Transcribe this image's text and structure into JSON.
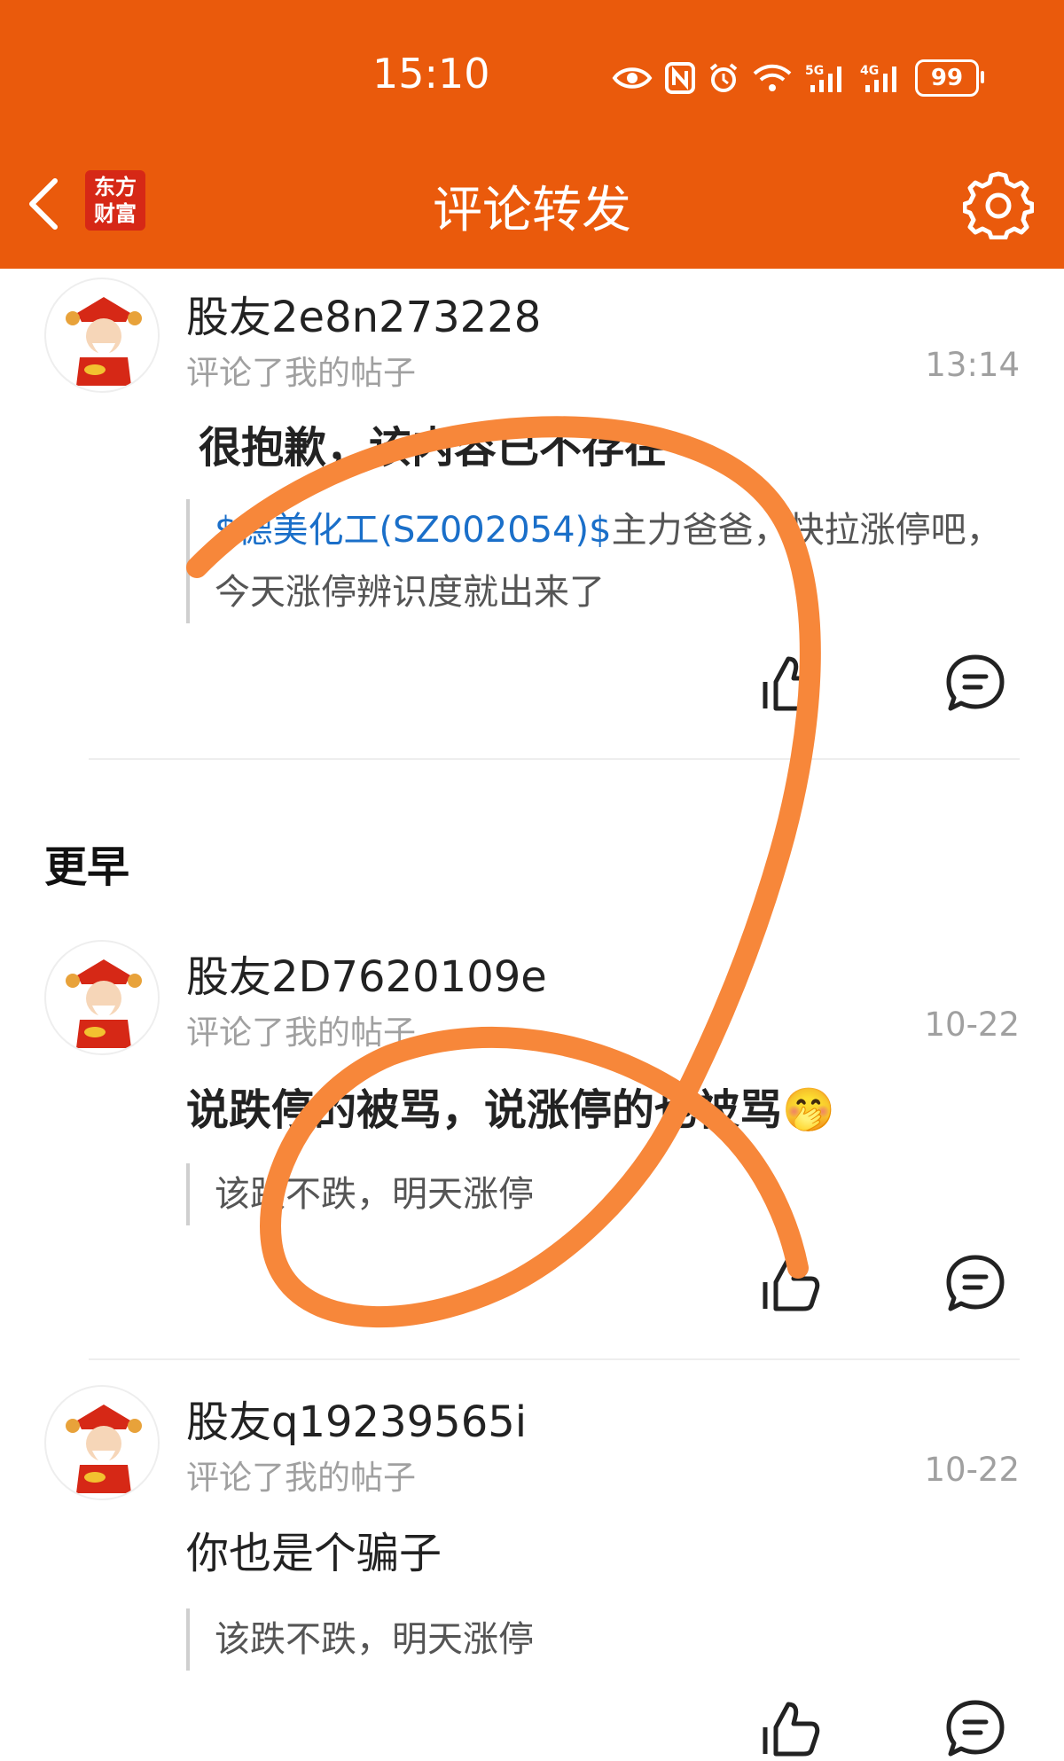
{
  "status_bar": {
    "time": "15:10",
    "icons": [
      "eye-icon",
      "nfc-icon",
      "alarm-icon",
      "wifi-icon",
      "5g-signal-icon",
      "4g-signal-icon"
    ],
    "battery": "99"
  },
  "header": {
    "back_icon": "chevron-left-icon",
    "logo_line1": "东方",
    "logo_line2": "财富",
    "title": "评论转发",
    "settings_icon": "gear-icon"
  },
  "notifications": [
    {
      "user": "股友2e8n273228",
      "action": "评论了我的帖子",
      "time": "13:14",
      "content": "很抱歉，该内容已不存在",
      "quote_link": "$德美化工(SZ002054)$",
      "quote_text": "主力爸爸，快拉涨停吧，今天涨停辨识度就出来了"
    },
    {
      "user": "股友2D7620109e",
      "action": "评论了我的帖子",
      "time": "10-22",
      "content": "说跌停的被骂，说涨停的也被骂",
      "emoji": "🤭",
      "quote_text": "该跌不跌，明天涨停"
    },
    {
      "user": "股友q19239565i",
      "action": "评论了我的帖子",
      "time": "10-22",
      "content": "你也是个骗子",
      "quote_text": "该跌不跌，明天涨停"
    }
  ],
  "section_earlier": "更早",
  "colors": {
    "brand": "#EA5A0C",
    "scribble": "#F7873A",
    "link": "#1a6fc9"
  }
}
